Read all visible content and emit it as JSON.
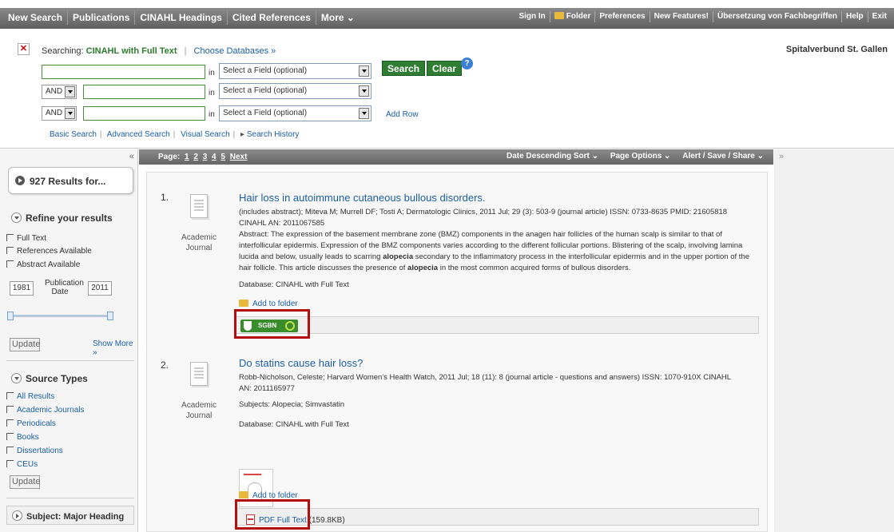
{
  "topnav": {
    "left": [
      "New Search",
      "Publications",
      "CINAHL Headings",
      "Cited References",
      "More ⌄"
    ],
    "right": [
      "Sign In",
      "Folder",
      "Preferences",
      "New Features!",
      "Übersetzung von Fachbegriffen",
      "Help",
      "Exit"
    ]
  },
  "search": {
    "searching_label": "Searching:",
    "database": "CINAHL with Full Text",
    "choose_db": "Choose Databases »",
    "organization": "Spitalverbund St. Gallen",
    "in_label": "in",
    "field_placeholder": "Select a Field (optional)",
    "bool_op": "AND",
    "search_button": "Search",
    "clear_button": "Clear",
    "help": "?",
    "add_row": "Add Row",
    "subnav": [
      "Basic Search",
      "Advanced Search",
      "Visual Search",
      "Search History"
    ]
  },
  "sidebar": {
    "collapse": "«",
    "results": "927 Results for...",
    "refine_title": "Refine your results",
    "refine_items": [
      "Full Text",
      "References Available",
      "Abstract Available"
    ],
    "year_from": "1981",
    "year_label": "Publication Date",
    "year_to": "2011",
    "update": "Update",
    "show_more": "Show More »",
    "source_title": "Source Types",
    "source_items": [
      "All Results",
      "Academic Journals",
      "Periodicals",
      "Books",
      "Dissertations",
      "CEUs"
    ],
    "subject_title": "Subject: Major Heading"
  },
  "pagebar": {
    "page_label": "Page:",
    "pages": [
      "1",
      "2",
      "3",
      "4",
      "5"
    ],
    "next": "Next",
    "sort": "Date Descending Sort ⌄",
    "page_options": "Page Options ⌄",
    "alert": "Alert / Save / Share ⌄",
    "expand": "»"
  },
  "results": [
    {
      "num": "1.",
      "type_line1": "Academic",
      "type_line2": "Journal",
      "title": "Hair loss in autoimmune cutaneous bullous disorders.",
      "meta1": "(includes abstract); Miteva M; Murrell DF; Tosti A; Dermatologic Clinics, 2011 Jul; 29 (3): 503-9 (journal article) ISSN: 0733-8635 PMID: 21605818",
      "meta2": "CINAHL AN: 2011067585",
      "abstract_1": "Abstract: The expression of the basement membrane zone (BMZ) components in the anagen hair follicles of the human scalp is similar to that of interfollicular epidermis. Expression of the BMZ components varies according to the different follicular portions. Blistering of the scalp, involving lamina lucida and below, usually leads to scarring ",
      "abstract_b1": "alopecia",
      "abstract_2": " secondary to the inflammatory process in the interfollicular epidermis and in the upper portion of the hair follicle. This article discusses the presence of ",
      "abstract_b2": "alopecia",
      "abstract_3": " in the most common acquired forms of bullous disorders.",
      "database": "Database: CINAHL with Full Text",
      "add_to_folder": "Add to folder",
      "link_label": "SGBN"
    },
    {
      "num": "2.",
      "type_line1": "Academic",
      "type_line2": "Journal",
      "title": "Do statins cause hair loss?",
      "meta1": "Robb-Nicholson, Celeste; Harvard Women's Health Watch, 2011 Jul; 18 (11): 8 (journal article - questions and answers) ISSN: 1070-910X CINAHL",
      "meta2": "AN: 2011165977",
      "subjects": "Subjects: Alopecia; Simvastatin",
      "database": "Database: CINAHL with Full Text",
      "add_to_folder": "Add to folder",
      "pdf_label": "PDF Full Text",
      "pdf_size": "(159.8KB)"
    }
  ],
  "right_panel": {
    "chevron": "»"
  }
}
